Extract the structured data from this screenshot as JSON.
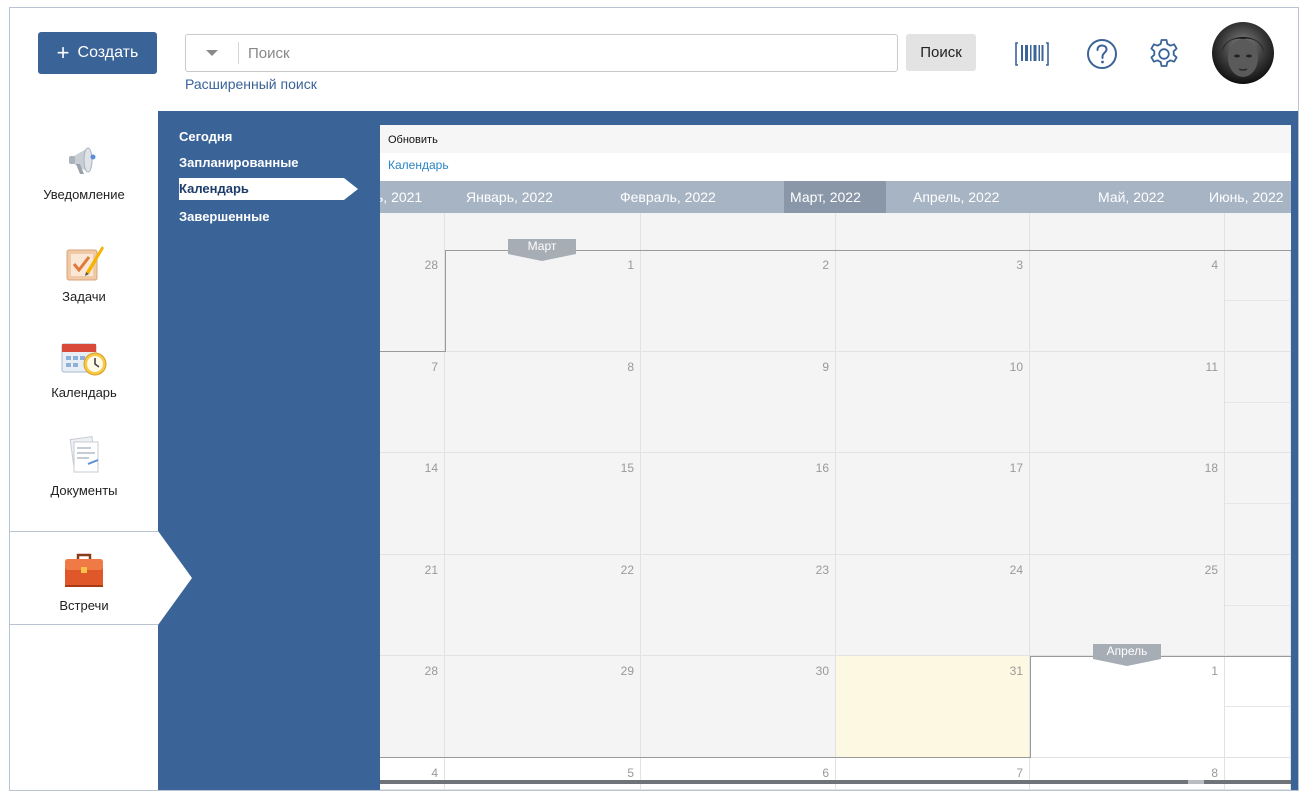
{
  "header": {
    "create_label": "Создать",
    "create_plus": "+",
    "search_placeholder": "Поиск",
    "search_button": "Поиск",
    "advanced_search": "Расширенный поиск",
    "icons": [
      "barcode-icon",
      "help-icon",
      "settings-icon"
    ]
  },
  "leftnav": {
    "items": [
      {
        "label": "Уведомление",
        "icon": "megaphone-icon"
      },
      {
        "label": "Задачи",
        "icon": "tasks-icon"
      },
      {
        "label": "Календарь",
        "icon": "calendar-clock-icon"
      },
      {
        "label": "Документы",
        "icon": "documents-icon"
      },
      {
        "label": "Встречи",
        "icon": "briefcase-icon"
      }
    ],
    "active": "Встречи"
  },
  "subnav": {
    "items": [
      "Сегодня",
      "Запланированные",
      "Календарь",
      "Завершенные"
    ],
    "active": "Календарь"
  },
  "calendar": {
    "refresh_label": "Обновить",
    "breadcrumb": "Календарь",
    "months": [
      "ь, 2021",
      "Январь, 2022",
      "Февраль, 2022",
      "Март, 2022",
      "Апрель, 2022",
      "Май, 2022",
      "Июнь, 2022"
    ],
    "selected_month": "Март, 2022",
    "flag_march": "Март",
    "flag_april": "Апрель",
    "weeks": [
      [
        "28",
        "1",
        "2",
        "3",
        "4"
      ],
      [
        "7",
        "8",
        "9",
        "10",
        "11"
      ],
      [
        "14",
        "15",
        "16",
        "17",
        "18"
      ],
      [
        "21",
        "22",
        "23",
        "24",
        "25"
      ],
      [
        "28",
        "29",
        "30",
        "31",
        "1"
      ],
      [
        "4",
        "5",
        "6",
        "7",
        "8"
      ]
    ],
    "today": "31",
    "colors": {
      "accent": "#3a6398",
      "month_bar": "#a7b4c4",
      "today_bg": "#fdf8e2",
      "link": "#2a84c6"
    }
  }
}
